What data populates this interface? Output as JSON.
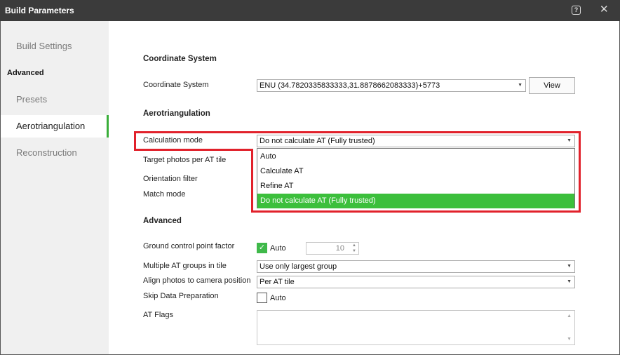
{
  "window": {
    "title": "Build Parameters",
    "help_icon": "?",
    "close_icon": "✕"
  },
  "sidebar": {
    "items": [
      {
        "label": "Build Settings",
        "active": false
      },
      {
        "label": "Advanced",
        "section": true
      },
      {
        "label": "Presets",
        "active": false
      },
      {
        "label": "Aerotriangulation",
        "active": true
      },
      {
        "label": "Reconstruction",
        "active": false
      }
    ]
  },
  "coordinate_system": {
    "heading": "Coordinate System",
    "label": "Coordinate System",
    "value": "ENU (34.7820335833333,31.8878662083333)+5773",
    "view_button": "View"
  },
  "aerotriangulation": {
    "heading": "Aerotriangulation",
    "calculation_mode_label": "Calculation mode",
    "calculation_mode_value": "Do not calculate AT (Fully trusted)",
    "target_photos_label": "Target photos per AT tile",
    "orientation_filter_label": "Orientation filter",
    "match_mode_label": "Match mode",
    "dropdown_options": [
      "Auto",
      "Calculate AT",
      "Refine AT",
      "Do not calculate AT (Fully trusted)"
    ],
    "dropdown_selected_index": 3
  },
  "advanced": {
    "heading": "Advanced",
    "gcp_factor_label": "Ground control point factor",
    "gcp_auto_label": "Auto",
    "gcp_auto_checked": true,
    "gcp_value": "10",
    "multiple_groups_label": "Multiple AT groups in tile",
    "multiple_groups_value": "Use only largest group",
    "align_photos_label": "Align photos to camera position",
    "align_photos_value": "Per AT tile",
    "skip_data_label": "Skip Data Preparation",
    "skip_data_auto_label": "Auto",
    "skip_data_checked": false,
    "at_flags_label": "AT Flags",
    "at_flags_value": ""
  },
  "colors": {
    "accent_green": "#3cbf3c",
    "annotation_red": "#e1212b",
    "titlebar": "#3b3b3b"
  }
}
